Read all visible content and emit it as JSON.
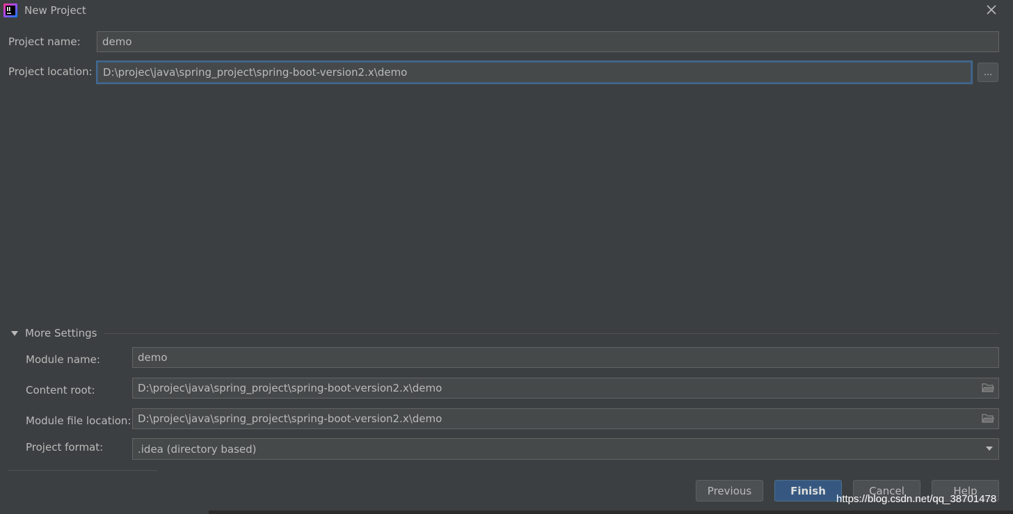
{
  "window": {
    "title": "New Project",
    "icon": "intellij-idea-icon",
    "close": "close-icon"
  },
  "form": {
    "project_name_label": "Project name:",
    "project_name_value": "demo",
    "project_location_label": "Project location:",
    "project_location_value": "D:\\projec\\java\\spring_project\\spring-boot-version2.x\\demo",
    "browse_label": "..."
  },
  "more_settings": {
    "toggle_label": "More Settings",
    "expanded": true,
    "module_name_label": "Module name:",
    "module_name_value": "demo",
    "content_root_label": "Content root:",
    "content_root_value": "D:\\projec\\java\\spring_project\\spring-boot-version2.x\\demo",
    "module_file_location_label": "Module file location:",
    "module_file_location_value": "D:\\projec\\java\\spring_project\\spring-boot-version2.x\\demo",
    "project_format_label": "Project format:",
    "project_format_value": ".idea (directory based)"
  },
  "buttons": {
    "previous": "Previous",
    "finish": "Finish",
    "cancel": "Cancel",
    "help": "Help"
  },
  "watermark": "https://blog.csdn.net/qq_38701478",
  "colors": {
    "background": "#3c3f41",
    "field_background": "#45494a",
    "focus_border": "#3d6185",
    "primary_button": "#365880",
    "text": "#bbbbbb"
  }
}
